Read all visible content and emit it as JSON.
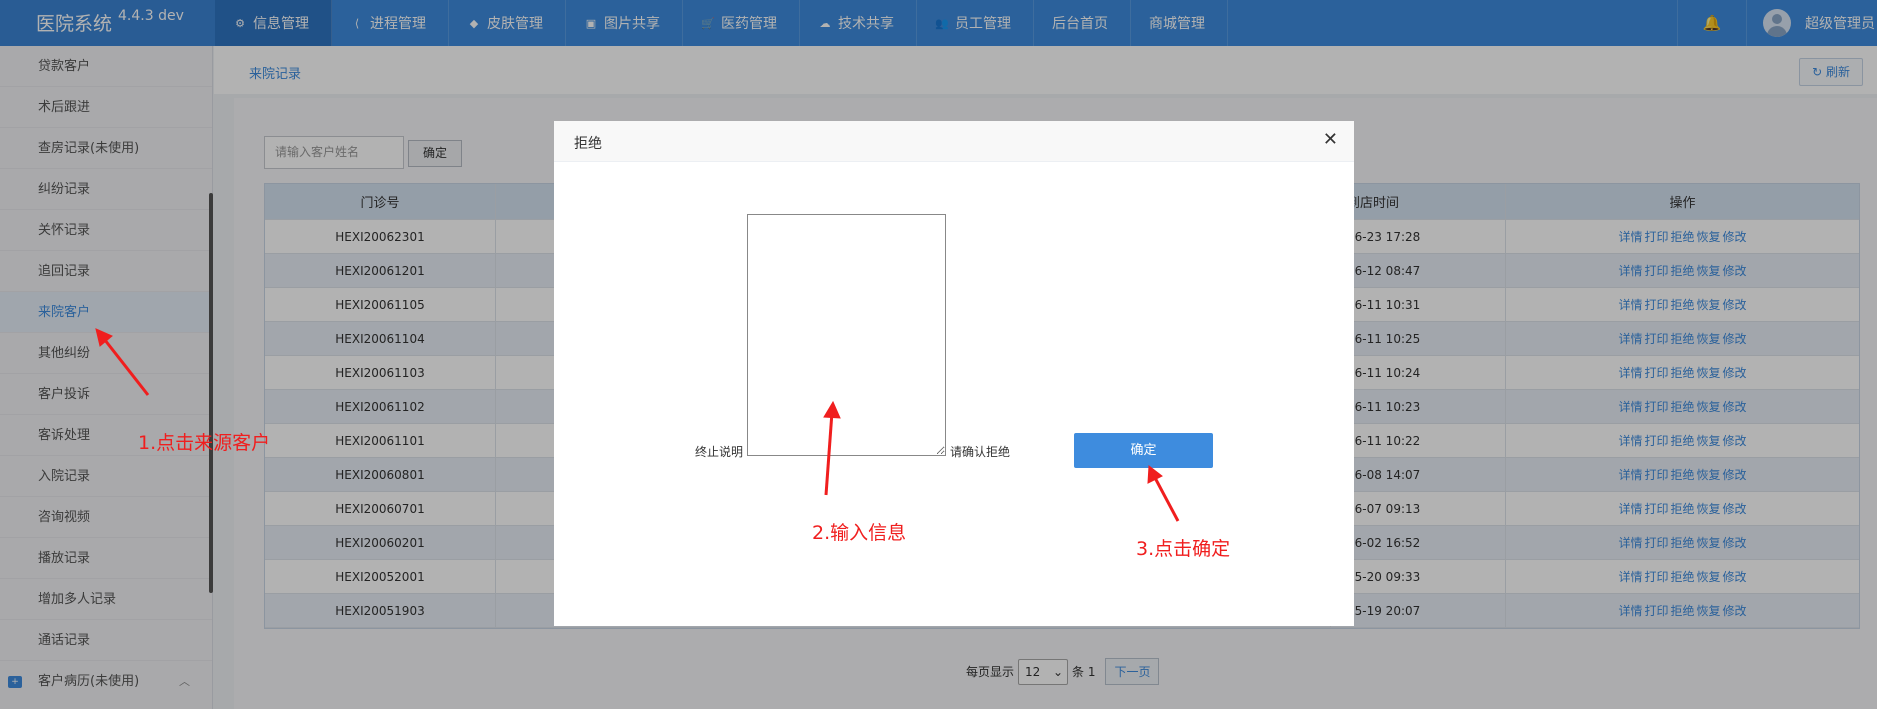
{
  "app": {
    "name": "医院系统",
    "version": "4.4.3 dev"
  },
  "nav": {
    "items": [
      {
        "label": "信息管理",
        "icon": "gear-icon",
        "glyph": "⚙",
        "active": true
      },
      {
        "label": "进程管理",
        "icon": "share-icon",
        "glyph": "⟨",
        "active": false
      },
      {
        "label": "皮肤管理",
        "icon": "tint-icon",
        "glyph": "◆",
        "active": false
      },
      {
        "label": "图片共享",
        "icon": "image-icon",
        "glyph": "▣",
        "active": false
      },
      {
        "label": "医药管理",
        "icon": "cart-icon",
        "glyph": "🛒",
        "active": false
      },
      {
        "label": "技术共享",
        "icon": "cloud-icon",
        "glyph": "☁",
        "active": false
      },
      {
        "label": "员工管理",
        "icon": "users-icon",
        "glyph": "👥",
        "active": false
      },
      {
        "label": "后台首页",
        "icon": "",
        "glyph": "",
        "active": false
      },
      {
        "label": "商城管理",
        "icon": "",
        "glyph": "",
        "active": false
      }
    ],
    "bell_glyph": "🔔",
    "user_name": "超级管理员"
  },
  "sidebar": {
    "items": [
      {
        "label": "贷款客户"
      },
      {
        "label": "术后跟进"
      },
      {
        "label": "查房记录(未使用)"
      },
      {
        "label": "纠纷记录"
      },
      {
        "label": "关怀记录"
      },
      {
        "label": "追回记录"
      },
      {
        "label": "来院客户",
        "active": true
      },
      {
        "label": "其他纠纷"
      },
      {
        "label": "客户投诉"
      },
      {
        "label": "客诉处理"
      },
      {
        "label": "入院记录"
      },
      {
        "label": "咨询视频"
      },
      {
        "label": "播放记录"
      },
      {
        "label": "增加多人记录"
      },
      {
        "label": "通话记录"
      }
    ],
    "group": {
      "label": "客户病历(未使用)",
      "chevron": "︿"
    }
  },
  "page": {
    "breadcrumb": "来院记录",
    "refresh_label": "刷新",
    "search": {
      "placeholder": "请输入客户姓名",
      "button_label": "确定"
    },
    "table": {
      "headers": [
        "门诊号",
        "",
        "到店时间",
        "操作"
      ],
      "header_time_visible": "到店时间",
      "actions": [
        "详情",
        "打印",
        "拒绝",
        "恢复",
        "修改"
      ],
      "rows": [
        {
          "id": "HEXI20062301",
          "time": "06-23 17:28"
        },
        {
          "id": "HEXI20061201",
          "time": "06-12 08:47"
        },
        {
          "id": "HEXI20061105",
          "time": "06-11 10:31"
        },
        {
          "id": "HEXI20061104",
          "time": "06-11 10:25"
        },
        {
          "id": "HEXI20061103",
          "time": "06-11 10:24"
        },
        {
          "id": "HEXI20061102",
          "time": "06-11 10:23"
        },
        {
          "id": "HEXI20061101",
          "time": "06-11 10:22"
        },
        {
          "id": "HEXI20060801",
          "time": "06-08 14:07"
        },
        {
          "id": "HEXI20060701",
          "time": "06-07 09:13"
        },
        {
          "id": "HEXI20060201",
          "time": "06-02 16:52"
        },
        {
          "id": "HEXI20052001",
          "time": "05-20 09:33"
        },
        {
          "id": "HEXI20051903",
          "time": "05-19 20:07"
        }
      ]
    },
    "pager": {
      "per_page_label": "每页显示",
      "per_page_value": "12",
      "count_label": "条 1",
      "next_label": "下一页"
    }
  },
  "modal": {
    "title": "拒绝",
    "close_glyph": "✕",
    "stop_label": "终止说明",
    "confirm_hint": "请确认拒绝",
    "ok_label": "确定"
  },
  "annotations": {
    "step1": "1.点击来源客户",
    "step2": "2.输入信息",
    "step3": "3.点击确定",
    "color": "#f01e1e"
  }
}
